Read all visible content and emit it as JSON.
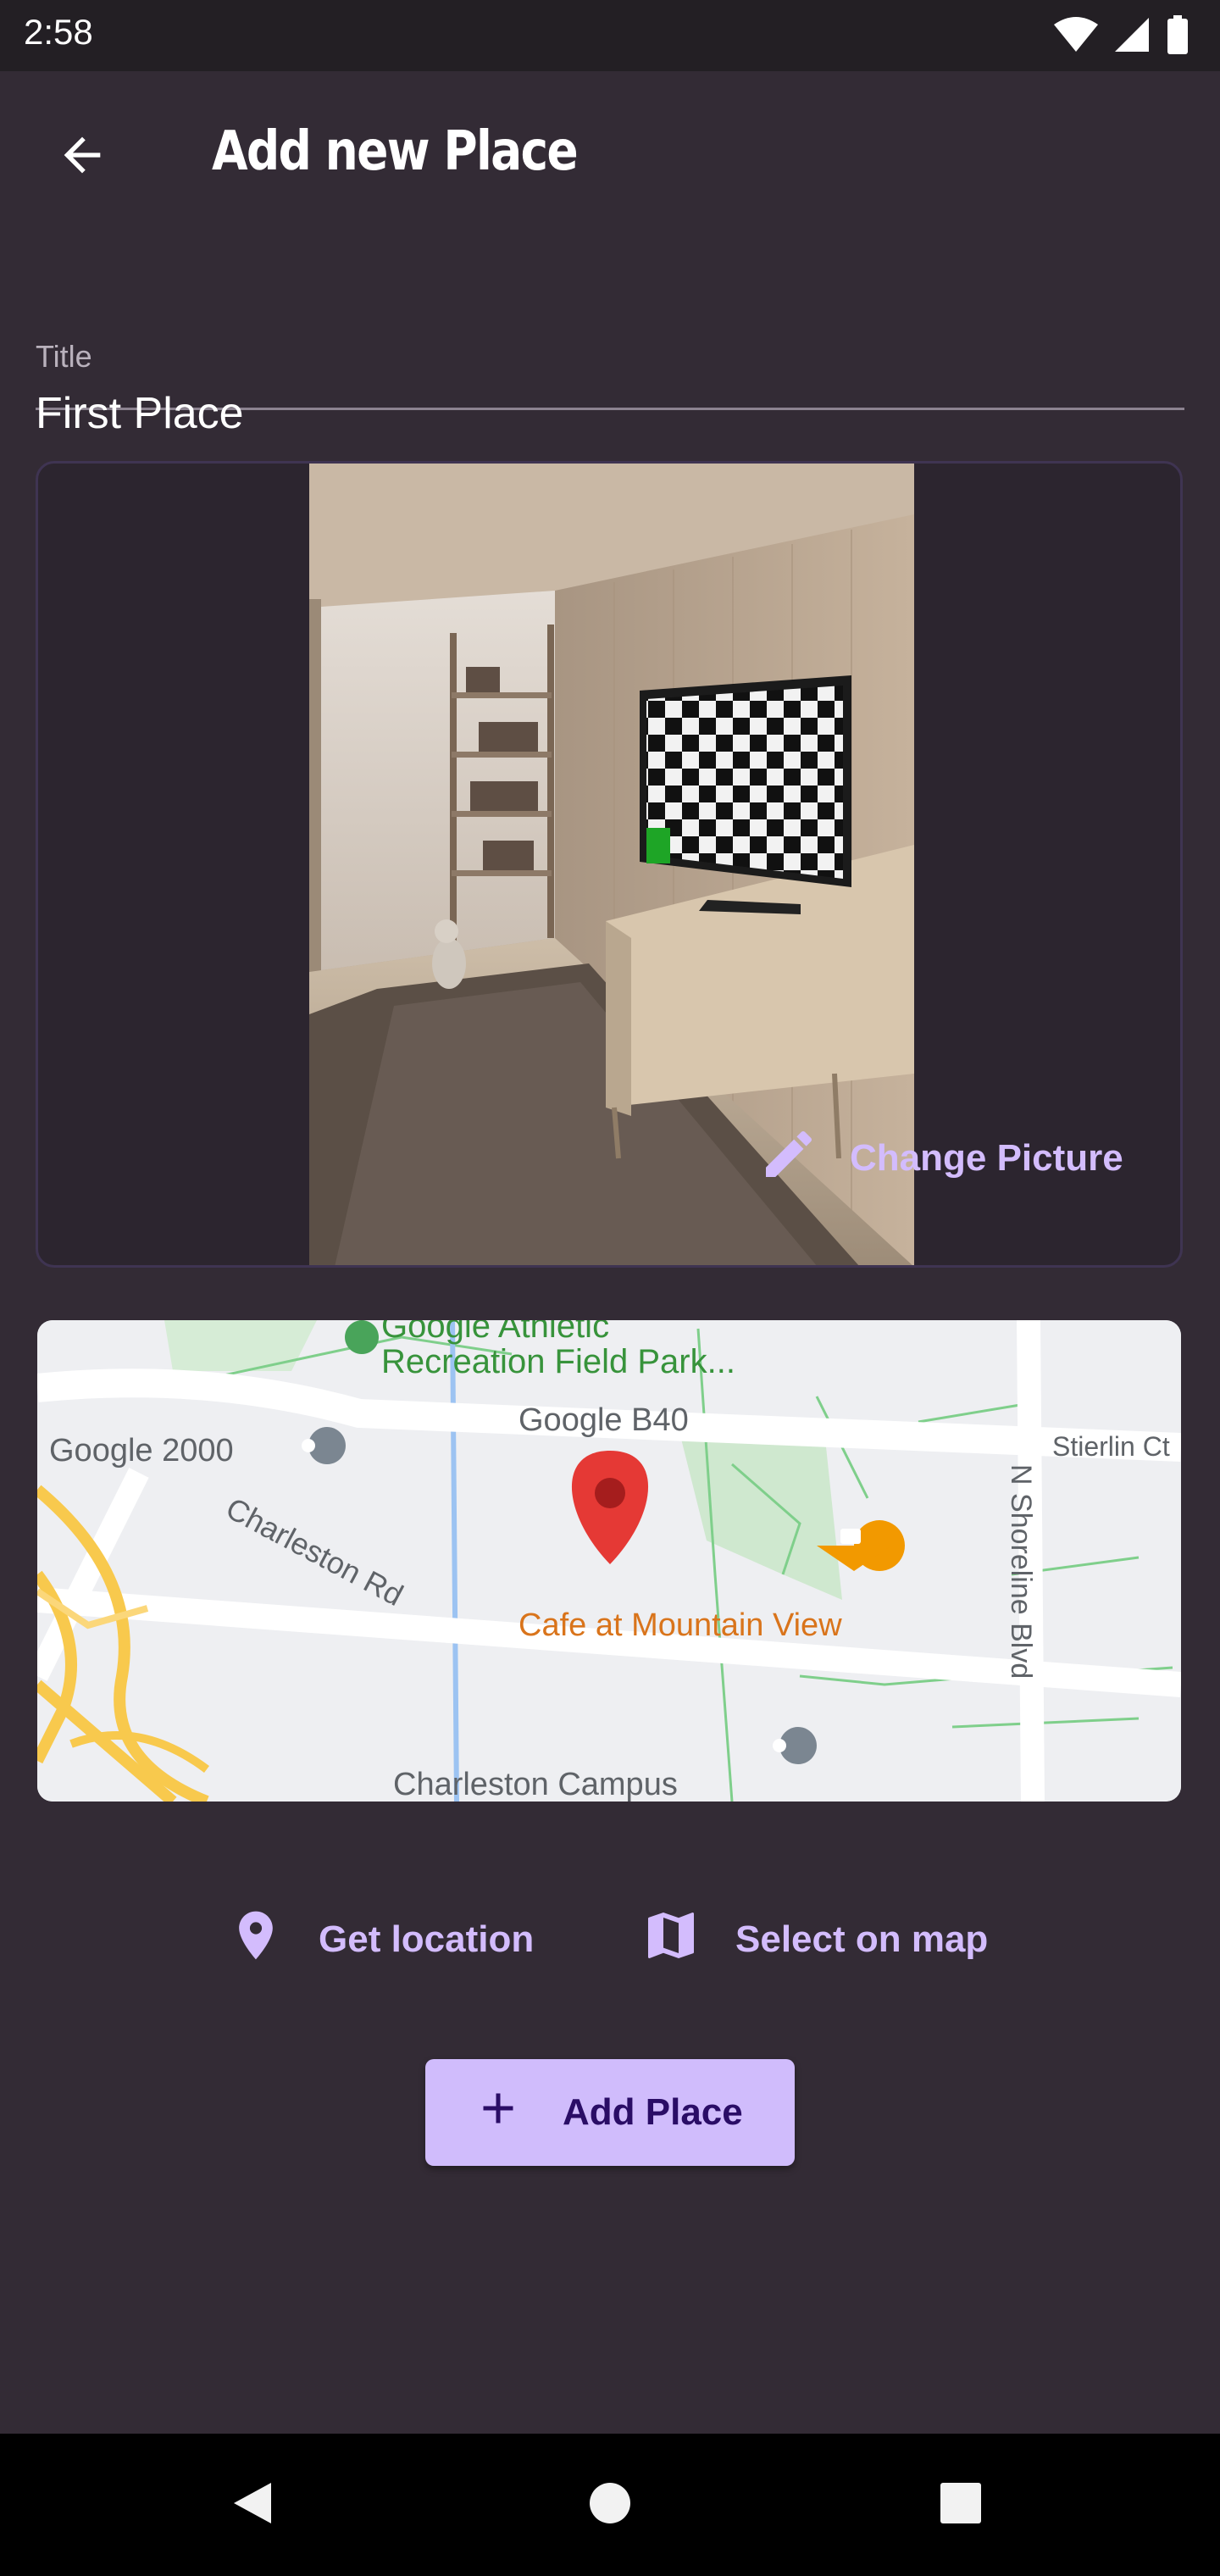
{
  "status_bar": {
    "time": "2:58",
    "icons": [
      "wifi-icon",
      "signal-icon",
      "battery-icon"
    ]
  },
  "app_bar": {
    "title": "Add new Place",
    "back_icon": "arrow-back-icon"
  },
  "form": {
    "title_label": "Title",
    "title_value": "First Place"
  },
  "image_card": {
    "change_picture_label": "Change Picture",
    "change_picture_icon": "pencil-icon"
  },
  "map": {
    "labels": {
      "poi_top": "Google Athletic\nRecreation Field Park...",
      "poi_top_line1": "Google Athletic",
      "poi_top_line2": "Recreation Field Park...",
      "google_b40": "Google B40",
      "google_2000": "Google 2000",
      "stierlin": "Stierlin Ct",
      "charleston_rd": "Charleston Rd",
      "cafe": "Cafe at Mountain View",
      "shoreline": "N Shoreline Blvd",
      "charleston_campus": "Charleston Campus"
    }
  },
  "actions": {
    "get_location_label": "Get location",
    "get_location_icon": "location-pin-icon",
    "select_on_map_label": "Select on map",
    "select_on_map_icon": "map-icon",
    "add_place_label": "Add Place",
    "add_place_icon": "plus-icon"
  },
  "colors": {
    "background": "#332b35",
    "accent": "#d3bcfd",
    "button_bg": "#d0bcfc",
    "button_text": "#2a0d66"
  }
}
